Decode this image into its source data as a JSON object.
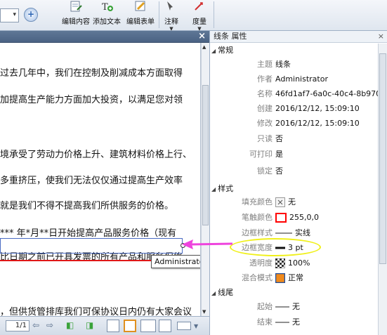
{
  "ribbon": {
    "buttons": [
      {
        "label": "编辑内容"
      },
      {
        "label": "添加文本"
      },
      {
        "label": "编辑表单"
      },
      {
        "label": "注释"
      },
      {
        "label": "度量"
      }
    ]
  },
  "document": {
    "close_glyph": "×",
    "lines": [
      "过去几年中，我们在控制及削减成本方面取得",
      "加提高生产能力方面加大投资，以满足您对领",
      "境承受了劳动力价格上升、建筑材料价格上行、",
      "多重挤压，使我们无法仅仅通过提高生产效率",
      "就是我们不得不提高我们所供服务的价格。",
      "***  年*月**日开始提高产品服务价格（现有",
      "比日期之前已开具发票的所有产品和服务保修",
      "，但供货管排库我们可保协议日内仍有大家会议"
    ],
    "tooltip": "Administrator",
    "page_number": "1/1"
  },
  "properties": {
    "title": "线条 属性",
    "close_glyph": "×",
    "sections": {
      "general": "常规",
      "style": "样式",
      "line_end": "线尾"
    },
    "general": [
      {
        "key": "主题",
        "value": "线条"
      },
      {
        "key": "作者",
        "value": "Administrator"
      },
      {
        "key": "名称",
        "value": "46fd1af7-6a0c-40c4-8b970.."
      },
      {
        "key": "创建",
        "value": "2016/12/12, 15:09:10"
      },
      {
        "key": "修改",
        "value": "2016/12/12, 15:09:10"
      },
      {
        "key": "只读",
        "value": "否"
      },
      {
        "key": "可打印",
        "value": "是"
      },
      {
        "key": "锁定",
        "value": "否"
      }
    ],
    "style": [
      {
        "key": "填充颜色",
        "value": "无"
      },
      {
        "key": "笔触颜色",
        "value": "255,0,0"
      },
      {
        "key": "边框样式",
        "value": "实线"
      },
      {
        "key": "边框宽度",
        "value": "3 pt"
      },
      {
        "key": "透明度",
        "value": "100%"
      },
      {
        "key": "混合模式",
        "value": "正常"
      }
    ],
    "line_end": [
      {
        "key": "起始",
        "value": "无"
      },
      {
        "key": "结束",
        "value": "无"
      }
    ]
  },
  "colors": {
    "stroke": "#ff0000",
    "highlight_ellipse": "#f0f01a",
    "arrow": "#ee44dd",
    "blend_mode_swatch": "#f08a1c"
  }
}
